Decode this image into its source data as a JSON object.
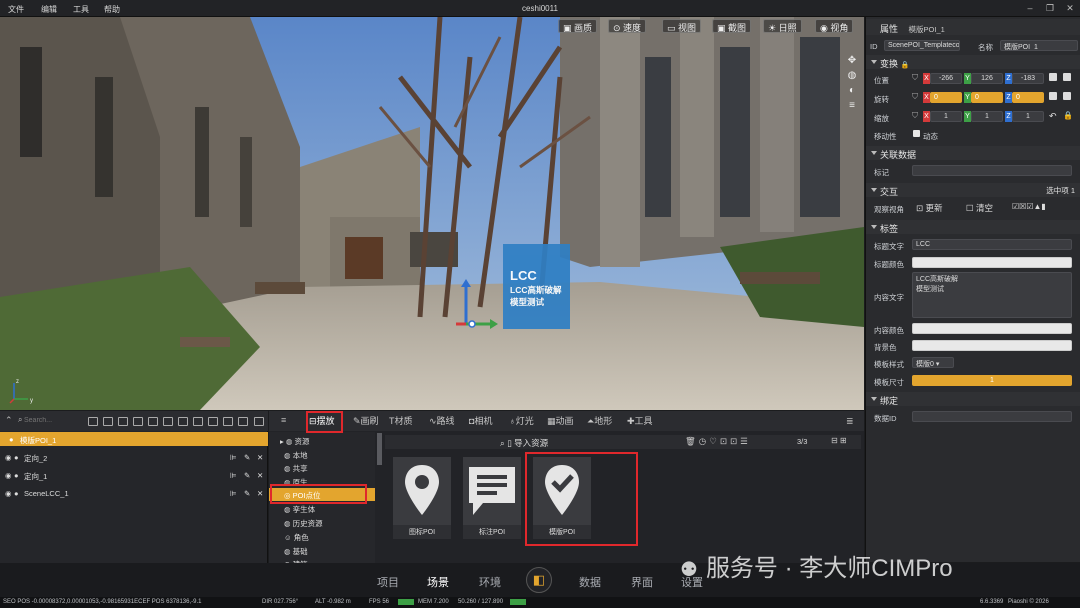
{
  "window": {
    "title": "ceshi0011",
    "menu": [
      "文件",
      "编辑",
      "工具",
      "帮助"
    ]
  },
  "viewport": {
    "toolbar": [
      {
        "icon": "image-icon",
        "label": "画质"
      },
      {
        "icon": "gauge-icon",
        "label": "速度"
      },
      {
        "icon": "view-icon",
        "label": "视图"
      },
      {
        "icon": "screenshot-icon",
        "label": "截图"
      },
      {
        "icon": "sun-icon",
        "label": "日照"
      },
      {
        "icon": "eye-icon",
        "label": "视角"
      }
    ],
    "poi": {
      "title": "LCC",
      "body1": "LCC高斯破解",
      "body2": "模型测试"
    },
    "axes": {
      "z": "z",
      "y": "y"
    }
  },
  "properties": {
    "header": "属性",
    "name_value": "模版POI_1",
    "id_label": "ID",
    "id_value": "ScenePOI_Templateco",
    "name_label": "名称",
    "name_field": "模版POI_1",
    "transform": {
      "title": "变换",
      "position": {
        "label": "位置",
        "x": "-266",
        "y": "126",
        "z": "-183"
      },
      "rotation": {
        "label": "旋转",
        "x": "0",
        "y": "0",
        "z": "0"
      },
      "scale": {
        "label": "缩放",
        "x": "1",
        "y": "1",
        "z": "1"
      },
      "movable": {
        "label": "移动性",
        "value": "动态"
      }
    },
    "related": {
      "title": "关联数据",
      "mark_label": "标记"
    },
    "interaction": {
      "title": "交互",
      "selected": "选中项 1",
      "observe_label": "观察视角",
      "update": "更新",
      "clear": "清空"
    },
    "label": {
      "title": "标签",
      "title_text_label": "标题文字",
      "title_text": "LCC",
      "title_color_label": "标题颜色",
      "content_label": "内容文字",
      "content_line1": "LCC高斯破解",
      "content_line2": "模型测试",
      "content_color_label": "内容颜色",
      "bg_color_label": "背景色",
      "template_style_label": "模板样式",
      "template_style": "模版0",
      "template_size_label": "模板尺寸",
      "template_size": "1"
    },
    "bind": {
      "title": "绑定",
      "data_id_label": "数据ID"
    }
  },
  "outliner": {
    "search_placeholder": "Search...",
    "items": [
      {
        "name": "模版POI_1",
        "selected": true
      },
      {
        "name": "定向_2",
        "selected": false
      },
      {
        "name": "定向_1",
        "selected": false
      },
      {
        "name": "SceneLCC_1",
        "selected": false
      }
    ]
  },
  "assets": {
    "tabs": [
      {
        "icon": "bed-icon",
        "label": "摆放",
        "active": true
      },
      {
        "icon": "brush-icon",
        "label": "画刷",
        "active": false
      },
      {
        "icon": "material-icon",
        "label": "材质",
        "active": false
      },
      {
        "icon": "route-icon",
        "label": "路线",
        "active": false
      },
      {
        "icon": "camera-icon",
        "label": "相机",
        "active": false
      },
      {
        "icon": "bulb-icon",
        "label": "灯光",
        "active": false
      },
      {
        "icon": "film-icon",
        "label": "动画",
        "active": false
      },
      {
        "icon": "terrain-icon",
        "label": "地形",
        "active": false
      },
      {
        "icon": "wrench-icon",
        "label": "工具",
        "active": false
      }
    ],
    "tree": [
      "资源",
      "本地",
      "共享",
      "原生",
      "POI点位",
      "孪生体",
      "历史资源",
      "角色",
      "基础",
      "建筑"
    ],
    "import_label": "导入资源",
    "page_count": "3/3",
    "cards": [
      {
        "icon": "map-pin-icon",
        "label": "图标POI"
      },
      {
        "icon": "note-icon",
        "label": "标注POI"
      },
      {
        "icon": "check-pin-icon",
        "label": "模版POI"
      }
    ]
  },
  "bottom_nav": [
    "项目",
    "场景",
    "环境",
    "数据",
    "界面",
    "设置"
  ],
  "watermark": "服务号 · 李大师CIMPro",
  "status": {
    "left": "SEO POS -0.00008372,0.00001053,-0.98165931ECEF POS 6378136,-9.1",
    "dir": "DIR 027.756°",
    "alt": "ALT -0.982 m",
    "fps": "FPS 56",
    "mem": "MEM 7.200",
    "gpu": "50.260 / 127.890",
    "version": "6.6.3369",
    "brand": "Piaoshi © 2026"
  },
  "colors": {
    "accent": "#e3a52e",
    "highlight_red": "#e0282c",
    "poi_blue": "#2f7fc4",
    "axis_x": "#d43a3a",
    "axis_y": "#3da046",
    "axis_z": "#2f6fd0"
  }
}
